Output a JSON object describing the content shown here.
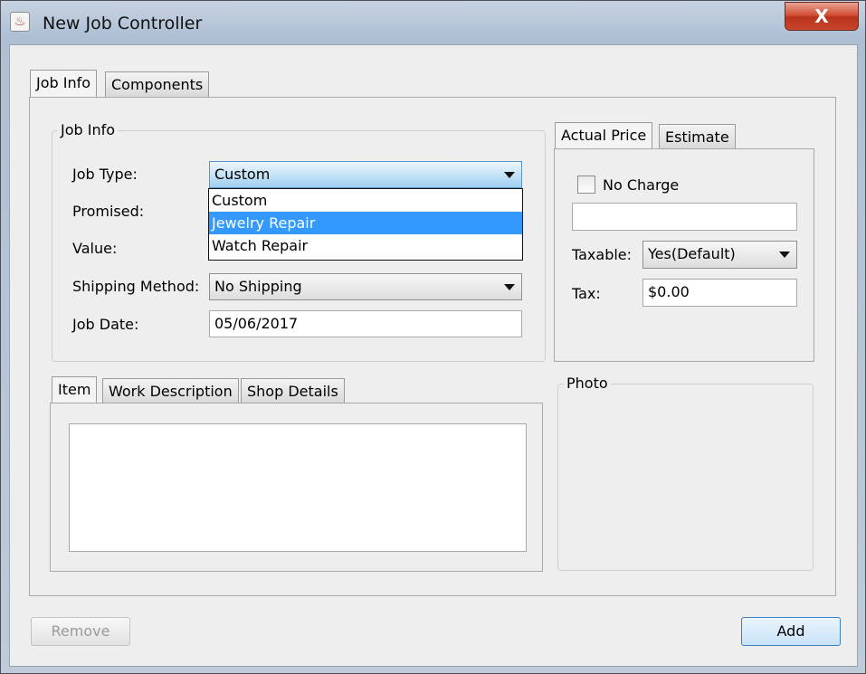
{
  "window": {
    "title": "New Job Controller",
    "close_symbol": "X",
    "app_icon": "java-cup-icon"
  },
  "main_tabs": [
    {
      "label": "Job Info",
      "selected": true
    },
    {
      "label": "Components",
      "selected": false
    }
  ],
  "job_info": {
    "legend": "Job Info",
    "job_type_label": "Job Type:",
    "job_type_value": "Custom",
    "job_type_options": [
      "Custom",
      "Jewelry Repair",
      "Watch Repair"
    ],
    "job_type_highlighted": "Jewelry Repair",
    "promised_label": "Promised:",
    "value_label": "Value:",
    "shipping_label": "Shipping Method:",
    "shipping_value": "No Shipping",
    "job_date_label": "Job Date:",
    "job_date_value": "05/06/2017"
  },
  "item_tabs": [
    {
      "label": "Item",
      "selected": true
    },
    {
      "label": "Work Description",
      "selected": false
    },
    {
      "label": "Shop Details",
      "selected": false
    }
  ],
  "price_tabs": [
    {
      "label": "Actual Price",
      "selected": true
    },
    {
      "label": "Estimate",
      "selected": false
    }
  ],
  "price": {
    "no_charge_label": "No Charge",
    "no_charge_checked": false,
    "amount_value": "",
    "taxable_label": "Taxable:",
    "taxable_value": "Yes(Default)",
    "tax_label": "Tax:",
    "tax_value": "$0.00"
  },
  "photo": {
    "legend": "Photo"
  },
  "buttons": {
    "remove": "Remove",
    "add": "Add"
  }
}
